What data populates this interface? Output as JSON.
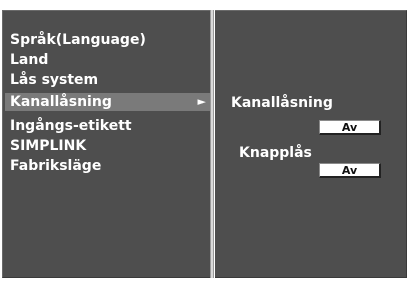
{
  "menu": {
    "items": [
      {
        "label": "Språk(Language)"
      },
      {
        "label": "Land"
      },
      {
        "label": "Lås system"
      },
      {
        "label": "Kanallåsning",
        "selected": true
      },
      {
        "label": "Ingångs-etikett"
      },
      {
        "label": "SIMPLINK"
      },
      {
        "label": "Fabriksläge"
      }
    ],
    "selected_arrow": "►"
  },
  "submenu": {
    "channel_lock": {
      "label": "Kanallåsning",
      "value": "Av"
    },
    "key_lock": {
      "label": "Knapplås",
      "value": "Av"
    }
  },
  "colors": {
    "panel": "#4e4e4e",
    "highlight": "#7a7a7a",
    "text": "#ffffff",
    "value_box": "#ffffff"
  }
}
